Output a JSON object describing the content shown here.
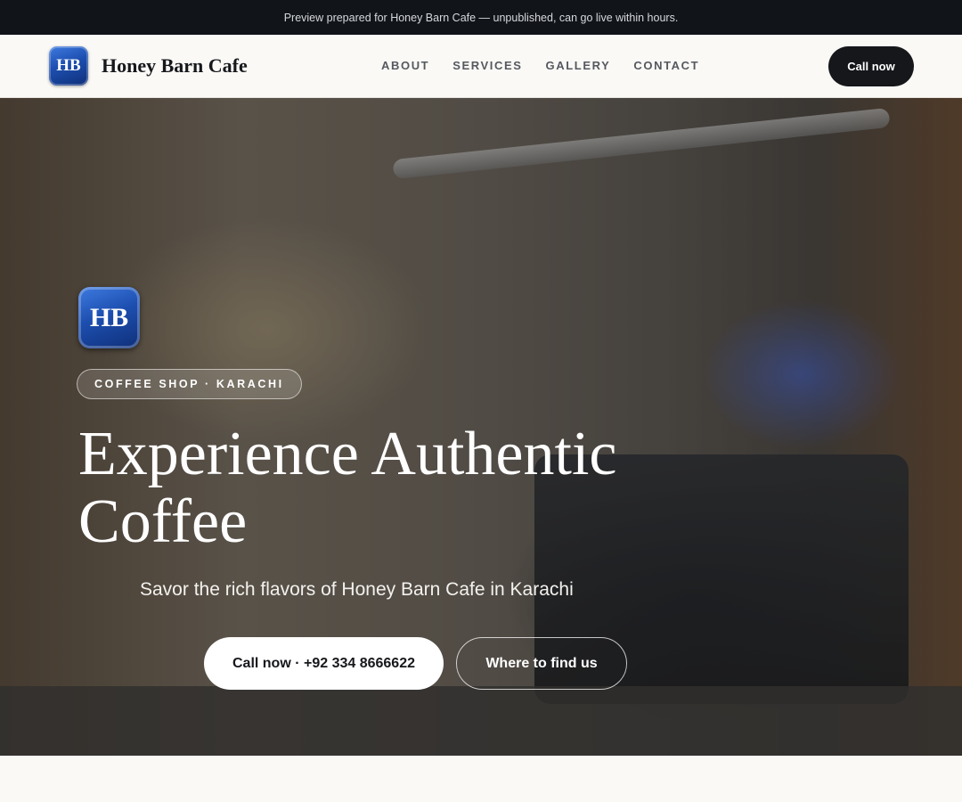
{
  "topbar": {
    "notice": "Preview prepared for Honey Barn Cafe — unpublished, can go live within hours."
  },
  "header": {
    "logo_initials": "HB",
    "brand_name": "Honey Barn Cafe",
    "nav": [
      {
        "label": "ABOUT"
      },
      {
        "label": "SERVICES"
      },
      {
        "label": "GALLERY"
      },
      {
        "label": "CONTACT"
      }
    ],
    "cta_label": "Call now"
  },
  "hero": {
    "logo_initials": "HB",
    "tag": "COFFEE SHOP · KARACHI",
    "headline": "Experience Authentic Coffee",
    "subheadline": "Savor the rich flavors of Honey Barn Cafe in Karachi",
    "primary_cta": "Call now · +92 334 8666622",
    "secondary_cta": "Where to find us"
  },
  "colors": {
    "topbar_bg": "#111418",
    "page_bg": "#faf9f6",
    "cta_dark": "#15171b",
    "logo_blue": "#1d4fb0"
  }
}
